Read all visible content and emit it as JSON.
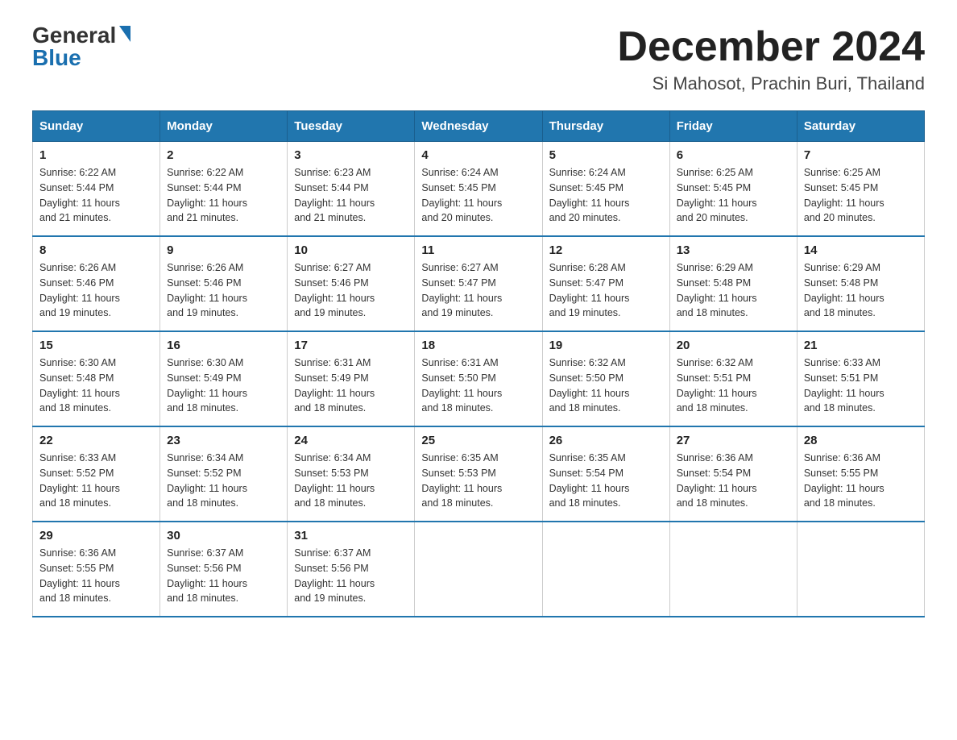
{
  "logo": {
    "general": "General",
    "blue": "Blue"
  },
  "header": {
    "title": "December 2024",
    "subtitle": "Si Mahosot, Prachin Buri, Thailand"
  },
  "weekdays": [
    "Sunday",
    "Monday",
    "Tuesday",
    "Wednesday",
    "Thursday",
    "Friday",
    "Saturday"
  ],
  "weeks": [
    [
      {
        "day": "1",
        "sunrise": "6:22 AM",
        "sunset": "5:44 PM",
        "daylight": "11 hours and 21 minutes."
      },
      {
        "day": "2",
        "sunrise": "6:22 AM",
        "sunset": "5:44 PM",
        "daylight": "11 hours and 21 minutes."
      },
      {
        "day": "3",
        "sunrise": "6:23 AM",
        "sunset": "5:44 PM",
        "daylight": "11 hours and 21 minutes."
      },
      {
        "day": "4",
        "sunrise": "6:24 AM",
        "sunset": "5:45 PM",
        "daylight": "11 hours and 20 minutes."
      },
      {
        "day": "5",
        "sunrise": "6:24 AM",
        "sunset": "5:45 PM",
        "daylight": "11 hours and 20 minutes."
      },
      {
        "day": "6",
        "sunrise": "6:25 AM",
        "sunset": "5:45 PM",
        "daylight": "11 hours and 20 minutes."
      },
      {
        "day": "7",
        "sunrise": "6:25 AM",
        "sunset": "5:45 PM",
        "daylight": "11 hours and 20 minutes."
      }
    ],
    [
      {
        "day": "8",
        "sunrise": "6:26 AM",
        "sunset": "5:46 PM",
        "daylight": "11 hours and 19 minutes."
      },
      {
        "day": "9",
        "sunrise": "6:26 AM",
        "sunset": "5:46 PM",
        "daylight": "11 hours and 19 minutes."
      },
      {
        "day": "10",
        "sunrise": "6:27 AM",
        "sunset": "5:46 PM",
        "daylight": "11 hours and 19 minutes."
      },
      {
        "day": "11",
        "sunrise": "6:27 AM",
        "sunset": "5:47 PM",
        "daylight": "11 hours and 19 minutes."
      },
      {
        "day": "12",
        "sunrise": "6:28 AM",
        "sunset": "5:47 PM",
        "daylight": "11 hours and 19 minutes."
      },
      {
        "day": "13",
        "sunrise": "6:29 AM",
        "sunset": "5:48 PM",
        "daylight": "11 hours and 18 minutes."
      },
      {
        "day": "14",
        "sunrise": "6:29 AM",
        "sunset": "5:48 PM",
        "daylight": "11 hours and 18 minutes."
      }
    ],
    [
      {
        "day": "15",
        "sunrise": "6:30 AM",
        "sunset": "5:48 PM",
        "daylight": "11 hours and 18 minutes."
      },
      {
        "day": "16",
        "sunrise": "6:30 AM",
        "sunset": "5:49 PM",
        "daylight": "11 hours and 18 minutes."
      },
      {
        "day": "17",
        "sunrise": "6:31 AM",
        "sunset": "5:49 PM",
        "daylight": "11 hours and 18 minutes."
      },
      {
        "day": "18",
        "sunrise": "6:31 AM",
        "sunset": "5:50 PM",
        "daylight": "11 hours and 18 minutes."
      },
      {
        "day": "19",
        "sunrise": "6:32 AM",
        "sunset": "5:50 PM",
        "daylight": "11 hours and 18 minutes."
      },
      {
        "day": "20",
        "sunrise": "6:32 AM",
        "sunset": "5:51 PM",
        "daylight": "11 hours and 18 minutes."
      },
      {
        "day": "21",
        "sunrise": "6:33 AM",
        "sunset": "5:51 PM",
        "daylight": "11 hours and 18 minutes."
      }
    ],
    [
      {
        "day": "22",
        "sunrise": "6:33 AM",
        "sunset": "5:52 PM",
        "daylight": "11 hours and 18 minutes."
      },
      {
        "day": "23",
        "sunrise": "6:34 AM",
        "sunset": "5:52 PM",
        "daylight": "11 hours and 18 minutes."
      },
      {
        "day": "24",
        "sunrise": "6:34 AM",
        "sunset": "5:53 PM",
        "daylight": "11 hours and 18 minutes."
      },
      {
        "day": "25",
        "sunrise": "6:35 AM",
        "sunset": "5:53 PM",
        "daylight": "11 hours and 18 minutes."
      },
      {
        "day": "26",
        "sunrise": "6:35 AM",
        "sunset": "5:54 PM",
        "daylight": "11 hours and 18 minutes."
      },
      {
        "day": "27",
        "sunrise": "6:36 AM",
        "sunset": "5:54 PM",
        "daylight": "11 hours and 18 minutes."
      },
      {
        "day": "28",
        "sunrise": "6:36 AM",
        "sunset": "5:55 PM",
        "daylight": "11 hours and 18 minutes."
      }
    ],
    [
      {
        "day": "29",
        "sunrise": "6:36 AM",
        "sunset": "5:55 PM",
        "daylight": "11 hours and 18 minutes."
      },
      {
        "day": "30",
        "sunrise": "6:37 AM",
        "sunset": "5:56 PM",
        "daylight": "11 hours and 18 minutes."
      },
      {
        "day": "31",
        "sunrise": "6:37 AM",
        "sunset": "5:56 PM",
        "daylight": "11 hours and 19 minutes."
      },
      null,
      null,
      null,
      null
    ]
  ],
  "labels": {
    "sunrise_prefix": "Sunrise: ",
    "sunset_prefix": "Sunset: ",
    "daylight_prefix": "Daylight: "
  }
}
